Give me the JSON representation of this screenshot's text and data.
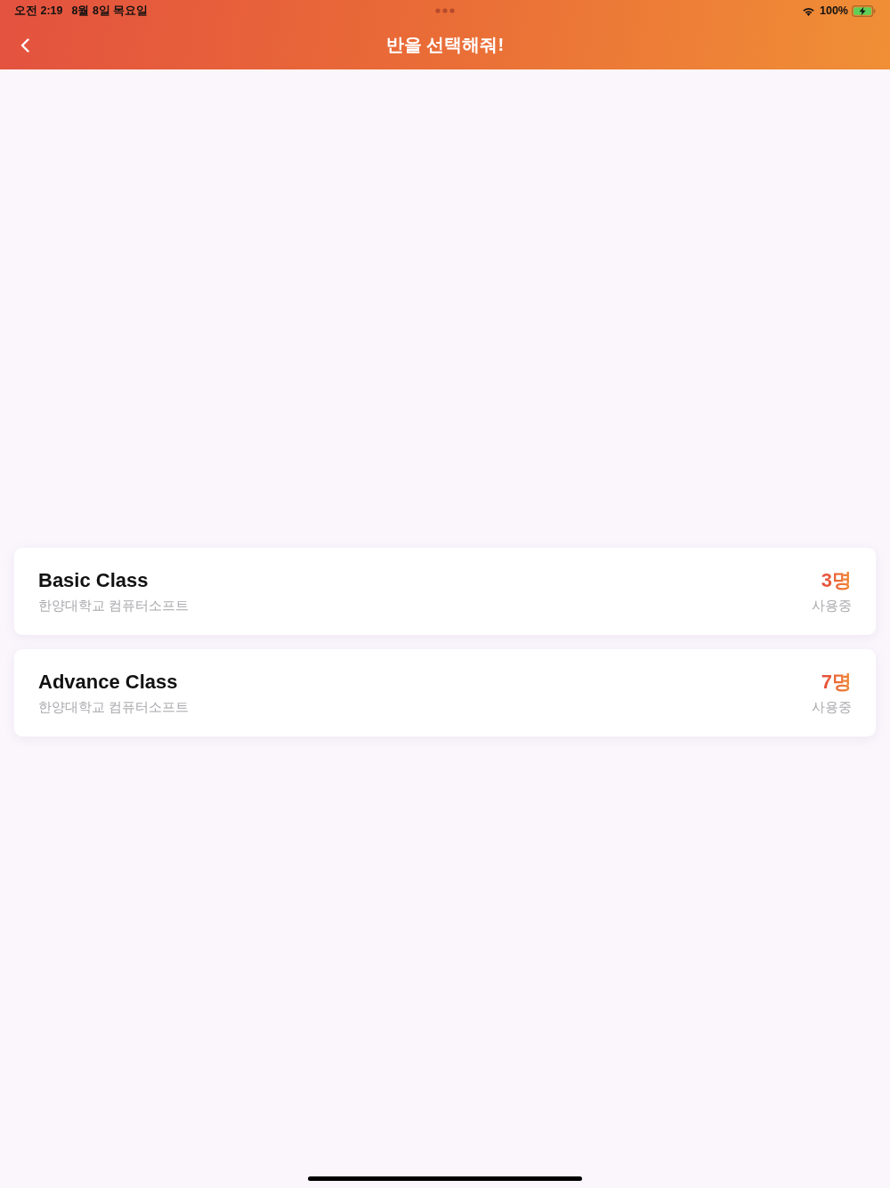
{
  "status_bar": {
    "time": "오전 2:19",
    "date": "8월 8일 목요일",
    "battery": "100%",
    "charging": true
  },
  "nav_bar": {
    "title": "반을 선택해줘!"
  },
  "classes": [
    {
      "name": "Basic Class",
      "school": "한양대학교 컴퓨터소프트",
      "count": "3명",
      "count_label": "사용중"
    },
    {
      "name": "Advance Class",
      "school": "한양대학교 컴퓨터소프트",
      "count": "7명",
      "count_label": "사용중"
    }
  ]
}
